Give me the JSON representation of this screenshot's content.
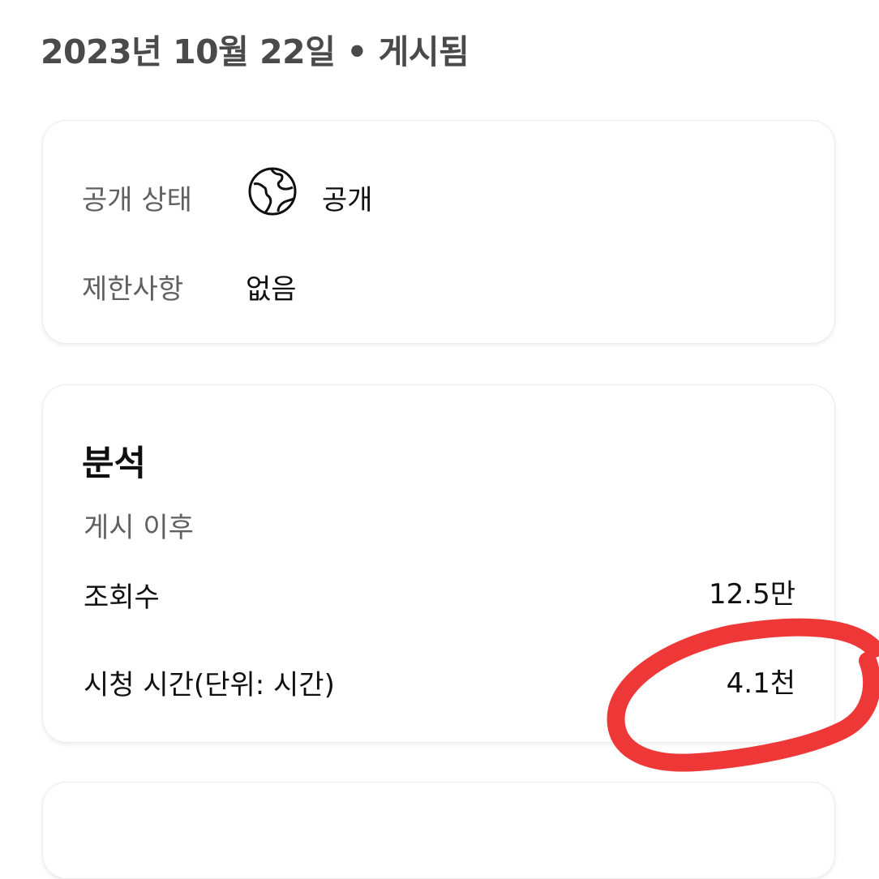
{
  "header": {
    "published_date": "2023년 10월 22일 • 게시됨"
  },
  "visibility_card": {
    "visibility_label": "공개 상태",
    "visibility_value": "공개",
    "visibility_icon": "globe-icon",
    "restrictions_label": "제한사항",
    "restrictions_value": "없음"
  },
  "analytics": {
    "title": "분석",
    "subtitle": "게시 이후",
    "views_label": "조회수",
    "views_value": "12.5만",
    "watch_time_label": "시청 시간(단위: 시간)",
    "watch_time_value": "4.1천"
  },
  "annotation": {
    "type": "red-circle",
    "color": "#ee3838"
  }
}
